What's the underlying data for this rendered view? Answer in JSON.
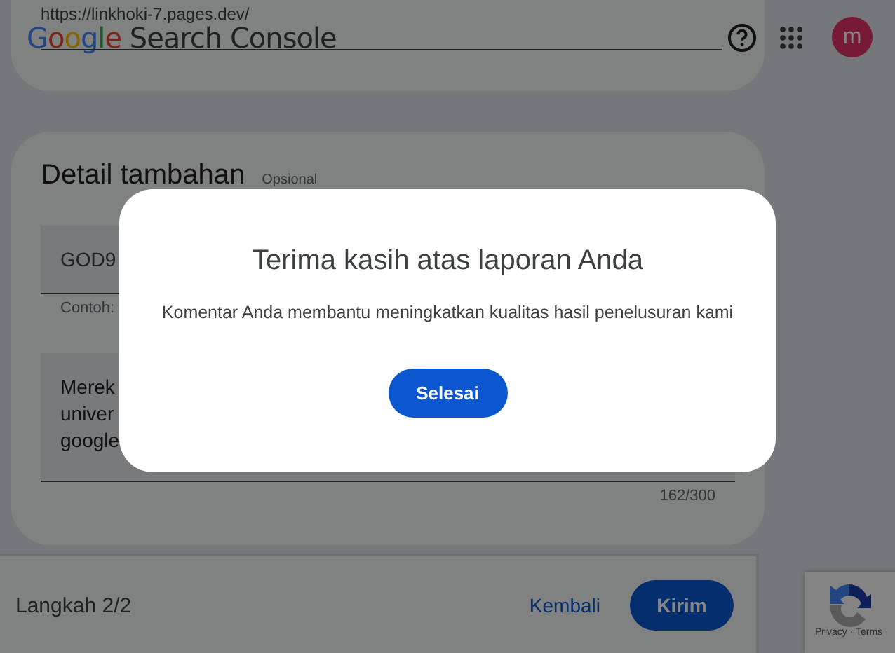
{
  "browser": {
    "url": "https://linkhoki-7.pages.dev/"
  },
  "header": {
    "logo": "Google",
    "product": "Search Console",
    "avatar": "m"
  },
  "form": {
    "title": "Detail tambahan",
    "optional": "Opsional",
    "field_value": "GOD9",
    "hint": "Contoh:",
    "comment_lines": [
      "Merek",
      "univer",
      "google"
    ],
    "counter": "162/300"
  },
  "footer": {
    "step": "Langkah 2/2",
    "back": "Kembali",
    "submit": "Kirim"
  },
  "recaptcha": {
    "links": "Privacy · Terms"
  },
  "dialog": {
    "title": "Terima kasih atas laporan Anda",
    "message": "Komentar Anda membantu meningkatkan kualitas hasil penelusuran kami",
    "button": "Selesai"
  }
}
